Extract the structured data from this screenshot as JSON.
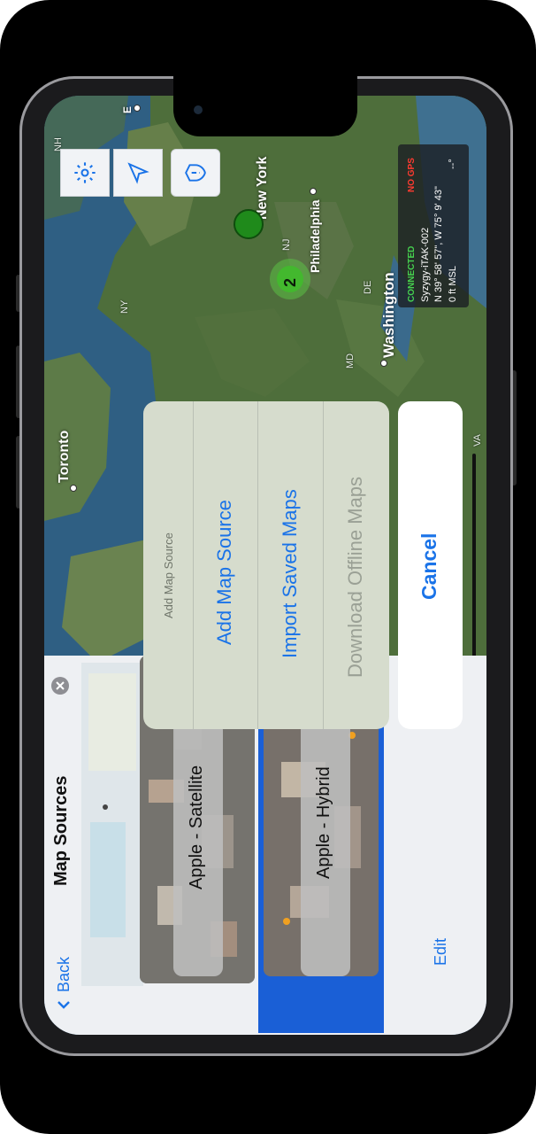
{
  "map": {
    "cities": [
      {
        "name": "New York",
        "key": "ny"
      },
      {
        "name": "Philadelphia",
        "key": "phl"
      },
      {
        "name": "Washington",
        "key": "dc"
      },
      {
        "name": "Toronto",
        "key": "to"
      }
    ],
    "states": [
      "NH",
      "NJ",
      "NY",
      "DE",
      "MD",
      "VA"
    ],
    "cluster_count": "2"
  },
  "status": {
    "connection": "CONNECTED",
    "gps": "NO GPS",
    "callsign": "Syzygy-iTAK-002",
    "coordinates": "N 39° 58' 57\", W 75° 9' 43\"",
    "altitude": "0 ft MSL",
    "extra": "--°",
    "colors": {
      "connected": "#46d14f",
      "no_gps": "#ff3b30"
    }
  },
  "controls": [
    "gear-icon",
    "location-arrow-icon",
    "shield-alert-icon"
  ],
  "map_sources": {
    "back_label": "Back",
    "title": "Map Sources",
    "edit_label": "Edit",
    "items": [
      {
        "label": "Apple - Satellite"
      },
      {
        "label": "Apple - Hybrid"
      }
    ]
  },
  "action_sheet": {
    "title": "Add Map Source",
    "items": [
      {
        "label": "Add Map Source",
        "enabled": true
      },
      {
        "label": "Import Saved Maps",
        "enabled": true
      },
      {
        "label": "Download Offline Maps",
        "enabled": false
      }
    ],
    "cancel_label": "Cancel",
    "accent": "#1a73e8"
  }
}
